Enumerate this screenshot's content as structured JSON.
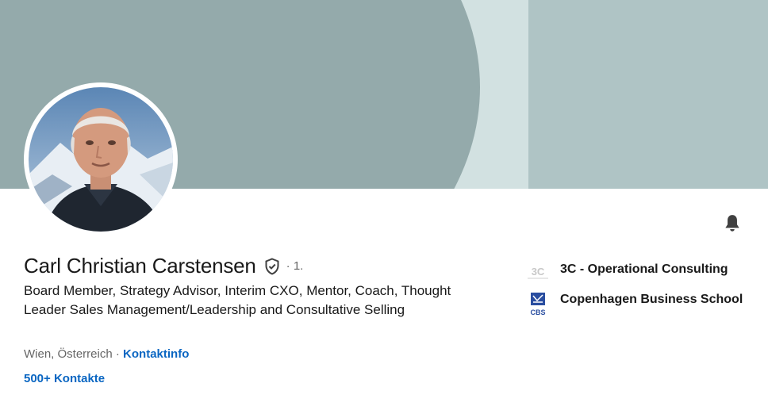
{
  "profile": {
    "name": "Carl Christian Carstensen",
    "degree": "· 1.",
    "headline": "Board Member, Strategy Advisor, Interim CXO, Mentor, Coach, Thought Leader Sales Management/Leadership and Consultative Selling",
    "location": "Wien, Österreich",
    "separator": " · ",
    "contact_info_link": "Kontaktinfo",
    "connections": "500+ Kontakte"
  },
  "organizations": [
    {
      "name": "3C - Operational Consulting",
      "logo_text": "3C",
      "icon": "company-logo"
    },
    {
      "name": "Copenhagen Business School",
      "logo_text": "CBS",
      "icon": "school-logo"
    }
  ],
  "icons": {
    "verified": "shield-check-icon",
    "notifications": "bell-icon"
  },
  "colors": {
    "banner_dark": "#94aaab",
    "banner_light": "#d2e1e1",
    "banner_mid": "#afc4c5",
    "link": "#0a66c2",
    "text": "#191919",
    "muted": "#666666"
  }
}
